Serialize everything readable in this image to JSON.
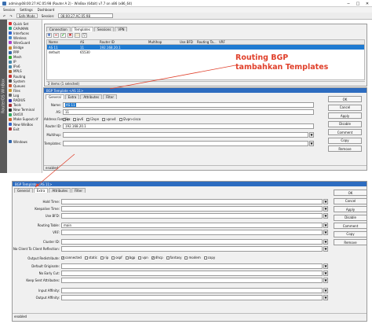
{
  "window": {
    "title": "admin@08:00:27:AC:05:98 (Router A 2) - WinBox (64bit) v7.7 on x86 (x86_64)",
    "minimize": "─",
    "maximize": "□",
    "close": "✕"
  },
  "menu": [
    "Session",
    "Settings",
    "Dashboard"
  ],
  "toolbar": {
    "safe_mode": "Safe Mode",
    "session_label": "Session:",
    "session_value": "08:00:27:AC:05:98"
  },
  "sidebar": {
    "strip_label": "RouterOS WinBox",
    "items": [
      "Quick Set",
      "CAPsMAN",
      "Interfaces",
      "Wireless",
      "WireGuard",
      "Bridge",
      "PPP",
      "Mesh",
      "IP",
      "IPv6",
      "MPLS",
      "Routing",
      "System",
      "Queues",
      "Files",
      "Log",
      "RADIUS",
      "Tools",
      "New Terminal",
      "Dot1X",
      "Make Supout.rif",
      "New WinBox",
      "Exit",
      "",
      "Windows"
    ]
  },
  "bgp_window": {
    "tabs": [
      "Connection",
      "Templates",
      "Sessions",
      "VPN"
    ],
    "active_tab": "Templates",
    "columns": [
      "Name",
      "AS",
      "Router ID",
      "Multihop",
      "Use BFD",
      "Routing Ta...",
      "VRF"
    ],
    "rows": [
      [
        "AS 11",
        "11",
        "192.168.20.1",
        "",
        "",
        "",
        ""
      ],
      [
        "default",
        "65530",
        "",
        "",
        "",
        "",
        ""
      ]
    ],
    "status": "2 items (1 selected)"
  },
  "annotation": {
    "line1": "Routing BGP",
    "line2": "tambahkan Templates"
  },
  "template_general": {
    "title": "BGP Template <AS 11>",
    "tabs": [
      "General",
      "Extra",
      "Attributes",
      "Filter"
    ],
    "active_tab": "General",
    "fields": {
      "name_label": "Name:",
      "name_value": "AS 11",
      "as_label": "AS:",
      "as_value": "11",
      "afi_label": "Address Families:",
      "afi": [
        {
          "label": "ip",
          "checked": true
        },
        {
          "label": "ipv6",
          "checked": false
        },
        {
          "label": "l2vpn",
          "checked": false
        },
        {
          "label": "vpnv4",
          "checked": false
        },
        {
          "label": "l2vpn-cisco",
          "checked": false
        }
      ],
      "router_id_label": "Router ID:",
      "router_id_value": "192.168.20.1",
      "multihop_label": "Multihop:",
      "templates_label": "Templates:"
    },
    "buttons": [
      "OK",
      "Cancel",
      "Apply",
      "Disable",
      "Comment",
      "Copy",
      "Remove"
    ],
    "status": "enabled"
  },
  "template_extra": {
    "title": "BGP Template <AS 11>",
    "tabs": [
      "General",
      "Extra",
      "Attributes",
      "Filter"
    ],
    "active_tab": "Extra",
    "fields": [
      {
        "label": "Hold Time:",
        "value": ""
      },
      {
        "label": "Keepalive Time:",
        "value": ""
      },
      {
        "label": "Use BFD:",
        "value": ""
      },
      {
        "label": "Routing Table:",
        "value": "main"
      },
      {
        "label": "VRF:",
        "value": ""
      },
      {
        "label": "Cluster ID:",
        "value": ""
      },
      {
        "label": "No Client To Client Reflection:",
        "value": ""
      }
    ],
    "redistribute_label": "Output Redistribute:",
    "redistribute": [
      {
        "label": "connected",
        "checked": true
      },
      {
        "label": "static",
        "checked": false
      },
      {
        "label": "rip",
        "checked": false
      },
      {
        "label": "ospf",
        "checked": false
      },
      {
        "label": "bgp",
        "checked": false
      },
      {
        "label": "vpn",
        "checked": false
      },
      {
        "label": "dhcp",
        "checked": true
      },
      {
        "label": "fantasy",
        "checked": false
      },
      {
        "label": "modem",
        "checked": false
      },
      {
        "label": "copy",
        "checked": false
      }
    ],
    "more_fields": [
      {
        "label": "Default Originate:",
        "value": ""
      },
      {
        "label": "No Early Cut:",
        "value": ""
      },
      {
        "label": "Keep Sent Attributes:",
        "value": ""
      },
      {
        "label": "Input Affinity:",
        "value": ""
      },
      {
        "label": "Output Affinity:",
        "value": ""
      }
    ],
    "buttons": [
      "OK",
      "Cancel",
      "Apply",
      "Disable",
      "Comment",
      "Copy",
      "Remove"
    ],
    "status": "enabled"
  },
  "colors": {
    "accent": "#2d6cc0",
    "annotation": "#e0402b",
    "selection": "#1f7ad1"
  }
}
